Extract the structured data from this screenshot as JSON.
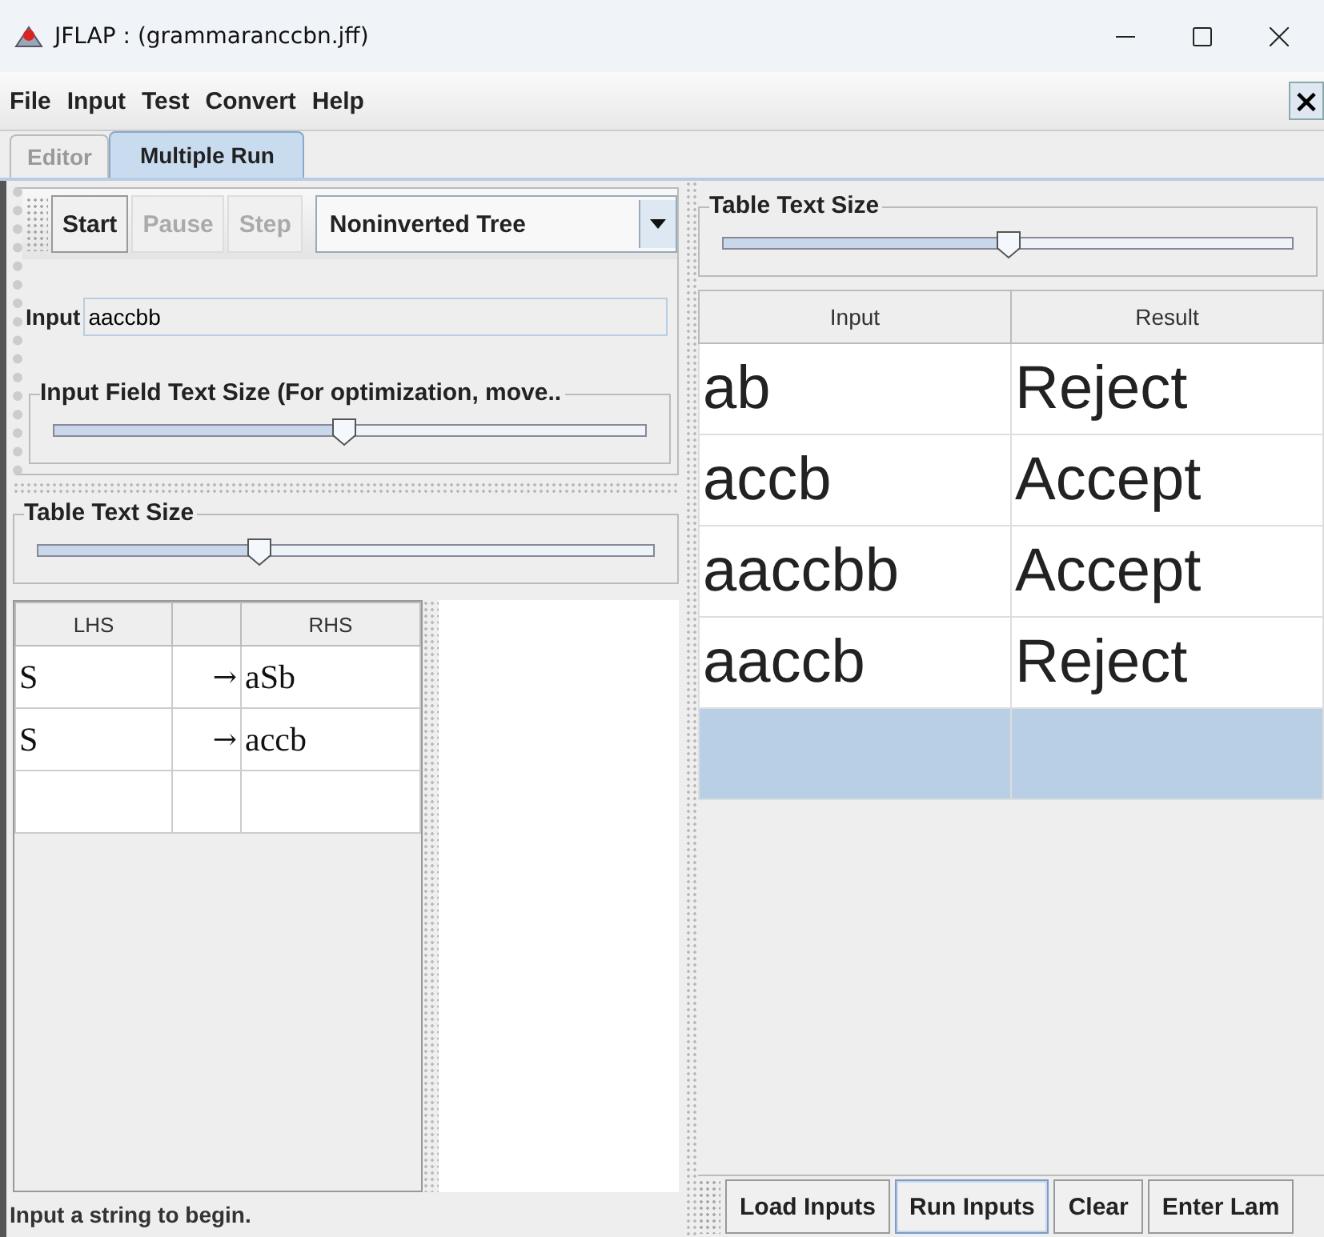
{
  "window": {
    "title": "JFLAP : (grammaranccbn.jff)"
  },
  "menu": [
    "File",
    "Input",
    "Test",
    "Convert",
    "Help"
  ],
  "close_button": "×",
  "tabs": [
    {
      "label": "Editor",
      "selected": false
    },
    {
      "label": "Multiple Run",
      "selected": true
    }
  ],
  "toolbar": {
    "buttons": [
      {
        "label": "Start",
        "disabled": false
      },
      {
        "label": "Pause",
        "disabled": true
      },
      {
        "label": "Step",
        "disabled": true
      }
    ],
    "view": "Noninverted Tree"
  },
  "input": {
    "label": "Input",
    "value": "aaccbb"
  },
  "input_size_slider": {
    "title": "Input Field Text Size (For optimization, move..",
    "level": 0.49
  },
  "grammar_size_slider": {
    "title": "Table Text Size",
    "level": 0.36
  },
  "grammar": {
    "columns": [
      "LHS",
      "RHS"
    ],
    "rows": [
      {
        "lhs": "S",
        "arrow": "→",
        "rhs": "aSb"
      },
      {
        "lhs": "S",
        "arrow": "→",
        "rhs": "accb"
      }
    ]
  },
  "status": "Input a string to begin.",
  "results_size_slider": {
    "title": "Table Text Size",
    "level": 0.5
  },
  "results": {
    "columns": [
      "Input",
      "Result"
    ],
    "rows": [
      {
        "input": "ab",
        "result": "Reject",
        "selected": false
      },
      {
        "input": "accb",
        "result": "Accept",
        "selected": false
      },
      {
        "input": "aaccbb",
        "result": "Accept",
        "selected": false
      },
      {
        "input": "aaccb",
        "result": "Reject",
        "selected": false
      },
      {
        "selected": true
      }
    ]
  },
  "buttons": [
    {
      "label": "Load Inputs",
      "focused": false
    },
    {
      "label": "Run Inputs",
      "focused": true
    },
    {
      "label": "Clear",
      "focused": false
    },
    {
      "label": "Enter Lam",
      "focused": false
    }
  ]
}
